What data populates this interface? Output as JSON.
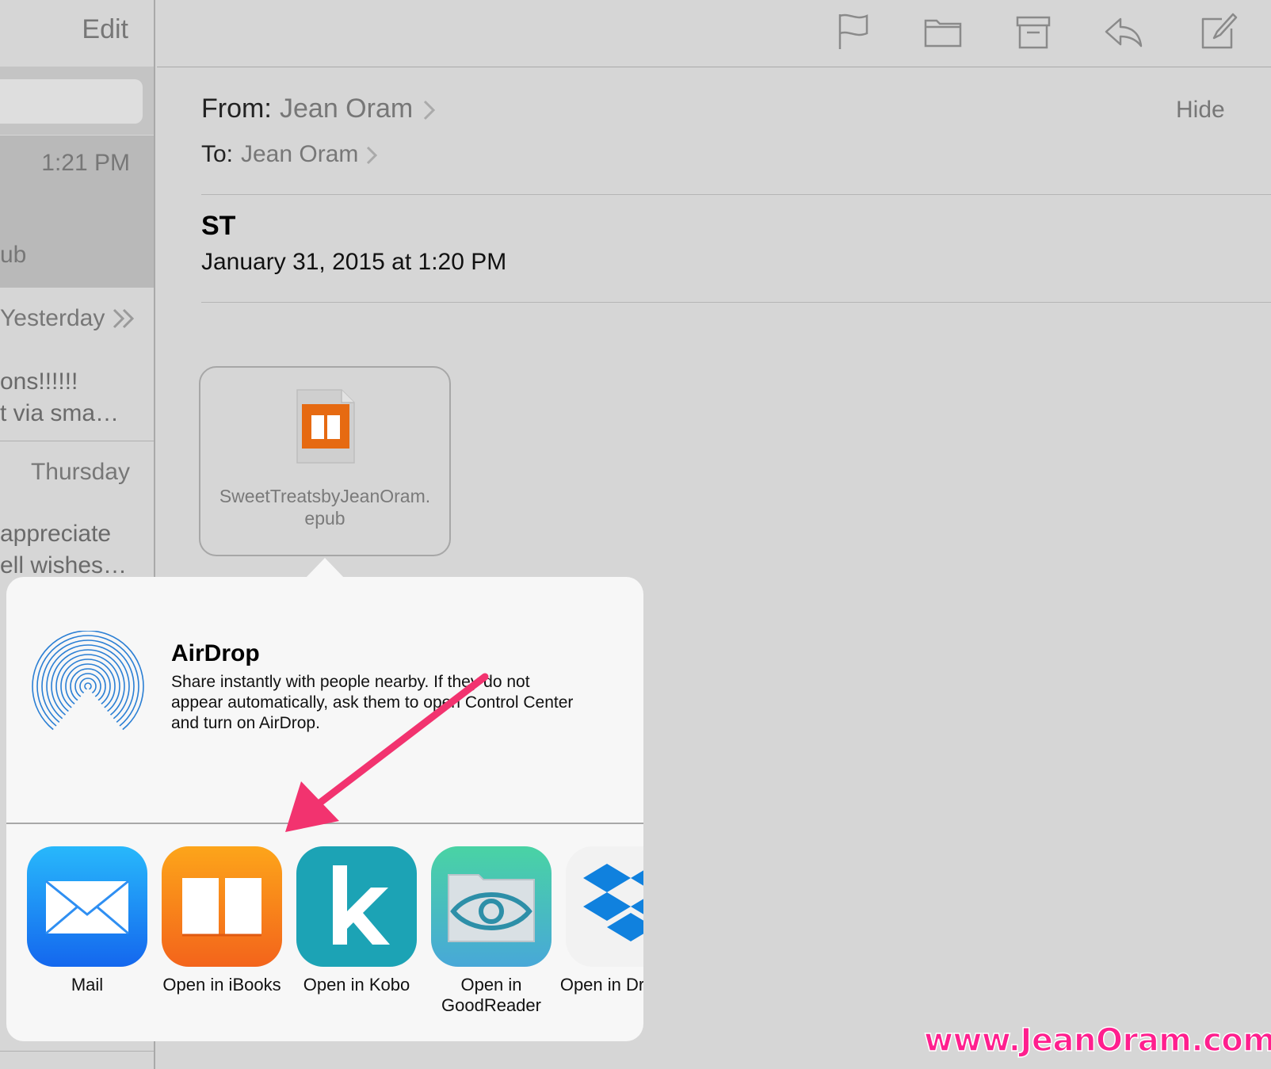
{
  "sidebar": {
    "edit_label": "Edit",
    "rows": [
      {
        "time": "1:21 PM",
        "snippet": "ub"
      },
      {
        "time": "Yesterday",
        "line1": "ons!!!!!!",
        "line2": "t via sma…"
      },
      {
        "time": "Thursday",
        "line1": "appreciate",
        "line2": "ell wishes…"
      }
    ]
  },
  "toolbar": {
    "icons": [
      "flag-icon",
      "folder-icon",
      "archive-icon",
      "reply-icon",
      "compose-icon"
    ]
  },
  "header": {
    "from_label": "From:",
    "from_name": "Jean Oram",
    "to_label": "To:",
    "to_name": "Jean Oram",
    "hide_label": "Hide",
    "subject": "ST",
    "date": "January 31, 2015 at 1:20 PM"
  },
  "attachment": {
    "filename_line1": "SweetTreatsbyJeanOram.",
    "filename_line2": "epub"
  },
  "share_sheet": {
    "airdrop_title": "AirDrop",
    "airdrop_description": "Share instantly with people nearby. If they do not appear automatically, ask them to open Control Center and turn on AirDrop.",
    "apps": [
      {
        "label": "Mail",
        "color": "#1d8df6"
      },
      {
        "label": "Open in iBooks",
        "color": "#f7871a"
      },
      {
        "label": "Open in Kobo",
        "color": "#1aa0b8"
      },
      {
        "label": "Open in GoodReader",
        "color": "#4cc6a2"
      },
      {
        "label": "Open in Dropbox",
        "color": "#1081de"
      }
    ]
  },
  "annotation": {
    "arrow_color": "#f2336f"
  },
  "watermark": "www.JeanOram.com"
}
